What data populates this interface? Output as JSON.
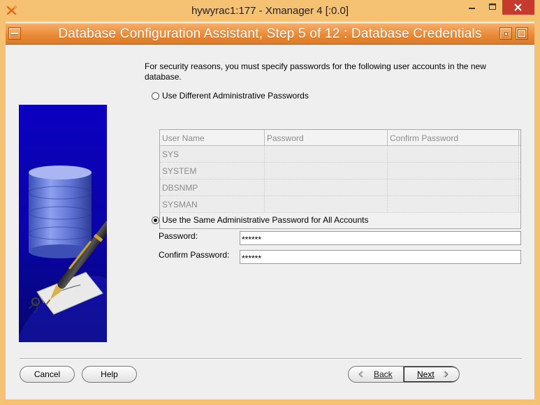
{
  "os_window": {
    "title": "hywyrac1:177 - Xmanager 4 [:0.0]"
  },
  "dialog": {
    "title": "Database Configuration Assistant, Step 5 of 12 : Database Credentials",
    "intro": "For security reasons, you must specify passwords for the following user accounts in the new database."
  },
  "options": {
    "different_label": "Use Different Administrative Passwords",
    "different_selected": false,
    "same_label": "Use the Same Administrative Password for All Accounts",
    "same_selected": true
  },
  "accounts_table": {
    "columns": [
      "User Name",
      "Password",
      "Confirm Password"
    ],
    "rows": [
      [
        "SYS",
        "",
        ""
      ],
      [
        "SYSTEM",
        "",
        ""
      ],
      [
        "DBSNMP",
        "",
        ""
      ],
      [
        "SYSMAN",
        "",
        ""
      ]
    ]
  },
  "fields": {
    "password_label": "Password:",
    "password_value": "******",
    "confirm_label": "Confirm Password:",
    "confirm_value": "******"
  },
  "buttons": {
    "cancel": "Cancel",
    "help": "Help",
    "back": "Back",
    "next": "Next"
  },
  "colors": {
    "titlebar_frame": "#f5c173",
    "inner_titlebar": "#e98a37",
    "close_button": "#c7382d",
    "illustration_background": "#0b00b8"
  }
}
